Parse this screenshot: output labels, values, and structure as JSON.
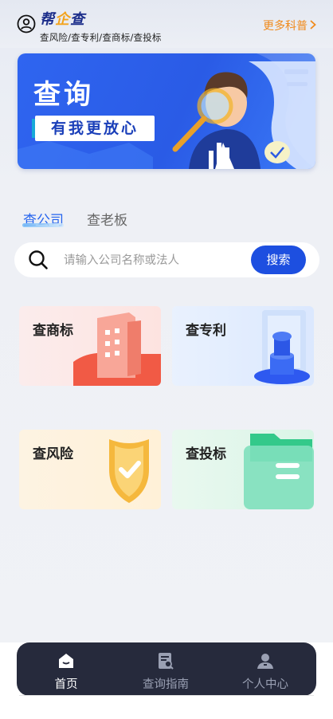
{
  "header": {
    "logo_left": "帮",
    "logo_mid": "企",
    "logo_right": "查",
    "subtitle": "查风险/查专利/查商标/查投标",
    "more_link": "更多科普"
  },
  "banner": {
    "title": "查询",
    "tag": "有我更放心"
  },
  "tabs": [
    {
      "label": "查公司",
      "active": true
    },
    {
      "label": "查老板",
      "active": false
    }
  ],
  "search": {
    "placeholder": "请输入公司名称或法人",
    "value": "",
    "button_label": "搜索"
  },
  "features": [
    {
      "label": "查商标",
      "icon": "building-icon"
    },
    {
      "label": "查专利",
      "icon": "stamp-icon"
    },
    {
      "label": "查风险",
      "icon": "shield-check-icon"
    },
    {
      "label": "查投标",
      "icon": "folder-icon"
    }
  ],
  "bottom_nav": [
    {
      "label": "首页",
      "icon": "home-icon",
      "active": true
    },
    {
      "label": "查询指南",
      "icon": "guide-icon",
      "active": false
    },
    {
      "label": "个人中心",
      "icon": "person-icon",
      "active": false
    }
  ],
  "colors": {
    "primary": "#1d4fe0",
    "accent_orange": "#f08a1b",
    "nav_background": "#262a3c"
  }
}
